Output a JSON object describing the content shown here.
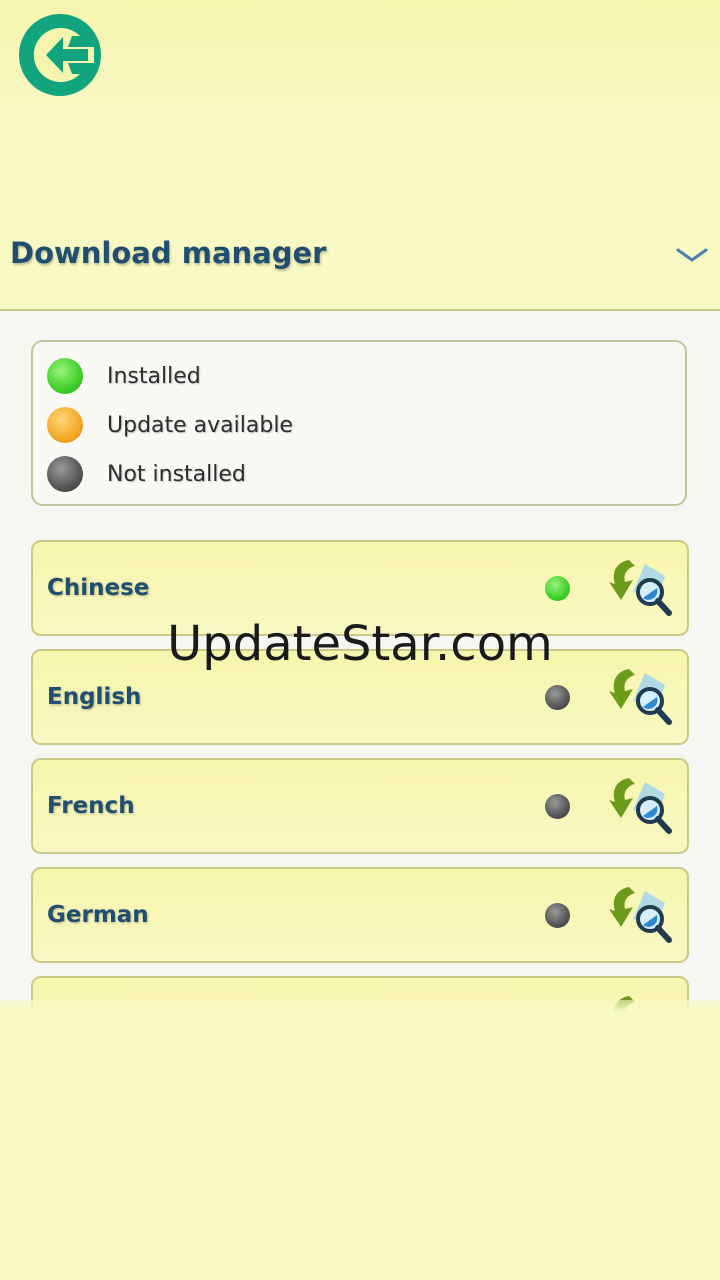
{
  "header": {
    "back_icon": "back-arrow-icon"
  },
  "section": {
    "title": "Download manager",
    "expand_icon": "chevron-down-icon"
  },
  "legend": [
    {
      "label": "Installed",
      "color": "#3fcf2a"
    },
    {
      "label": "Update available",
      "color": "#f2a826"
    },
    {
      "label": "Not installed",
      "color": "#555555"
    }
  ],
  "languages": [
    {
      "name": "Chinese",
      "status": "Installed"
    },
    {
      "name": "English",
      "status": "Not installed"
    },
    {
      "name": "French",
      "status": "Not installed"
    },
    {
      "name": "German",
      "status": "Not installed"
    }
  ],
  "watermark": "UpdateStar.com",
  "colors": {
    "accent": "#12a37f",
    "title": "#1f4e6e",
    "background": "#f9f9c5",
    "installed": "#3fcf2a",
    "update": "#f2a826",
    "not_installed": "#555555"
  }
}
